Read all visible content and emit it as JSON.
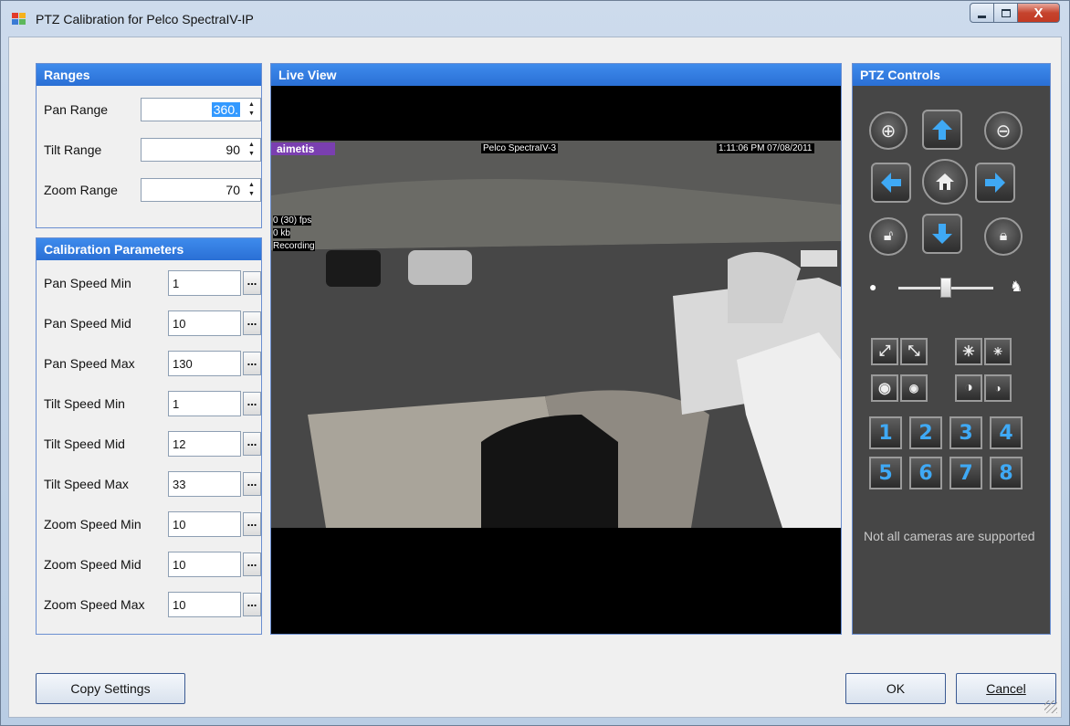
{
  "window": {
    "title": "PTZ Calibration for Pelco SpectraIV-IP",
    "close_glyph": "X"
  },
  "ranges": {
    "header": "Ranges",
    "rows": [
      {
        "label": "Pan Range",
        "value": "360."
      },
      {
        "label": "Tilt Range",
        "value": "90"
      },
      {
        "label": "Zoom Range",
        "value": "70"
      }
    ]
  },
  "calibration": {
    "header": "Calibration Parameters",
    "browse_label": "...",
    "rows": [
      {
        "label": "Pan Speed Min",
        "value": "1"
      },
      {
        "label": "Pan Speed Mid",
        "value": "10"
      },
      {
        "label": "Pan Speed Max",
        "value": "130"
      },
      {
        "label": "Tilt Speed Min",
        "value": "1"
      },
      {
        "label": "Tilt Speed Mid",
        "value": "12"
      },
      {
        "label": "Tilt Speed Max",
        "value": "33"
      },
      {
        "label": "Zoom Speed Min",
        "value": "10"
      },
      {
        "label": "Zoom Speed Mid",
        "value": "10"
      },
      {
        "label": "Zoom Speed Max",
        "value": "10"
      }
    ]
  },
  "live_view": {
    "header": "Live View",
    "overlay_brand": "aimetis",
    "overlay_camera": "Pelco SpectraIV-3",
    "overlay_time": "1:11:06 PM 07/08/2011",
    "overlay_fps": "0 (30) fps",
    "overlay_size": "0 kb",
    "overlay_status": "Recording"
  },
  "ptz": {
    "header": "PTZ Controls",
    "speed_level": 0.5,
    "presets": [
      "1",
      "2",
      "3",
      "4",
      "5",
      "6",
      "7",
      "8"
    ],
    "note": "Not all cameras are supported"
  },
  "footer": {
    "copy_label": "Copy Settings",
    "ok_label": "OK",
    "cancel_label": "Cancel"
  },
  "colors": {
    "header_blue": "#2a6fd5",
    "ptz_panel": "#464646",
    "arrow_blue": "#3fa9f5"
  }
}
